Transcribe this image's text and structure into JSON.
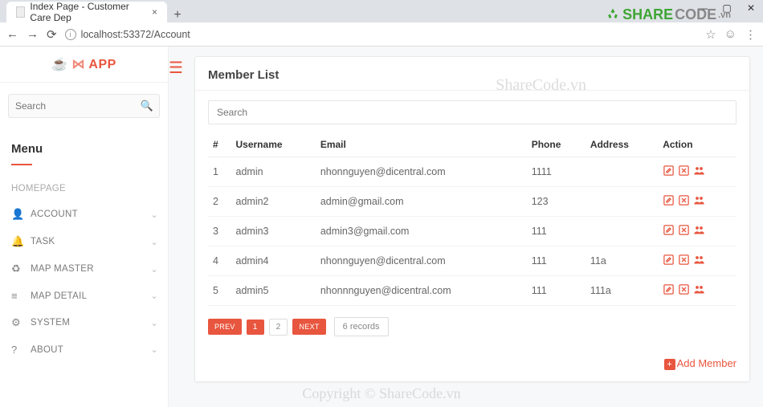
{
  "browser": {
    "tab_title": "Index Page - Customer Care Dep",
    "url": "localhost:53372/Account"
  },
  "brand": "APP",
  "sidebar": {
    "search_placeholder": "Search",
    "menu_label": "Menu",
    "items": [
      {
        "icon": "",
        "label": "HOMEPAGE",
        "chev": false
      },
      {
        "icon": "👤",
        "label": "ACCOUNT",
        "chev": true
      },
      {
        "icon": "🔔",
        "label": "TASK",
        "chev": true
      },
      {
        "icon": "♻",
        "label": "MAP MASTER",
        "chev": true
      },
      {
        "icon": "≡",
        "label": "MAP DETAIL",
        "chev": true
      },
      {
        "icon": "⚙",
        "label": "SYSTEM",
        "chev": true
      },
      {
        "icon": "?",
        "label": "ABOUT",
        "chev": true
      }
    ]
  },
  "card": {
    "title": "Member List",
    "search_placeholder": "Search",
    "columns": [
      "#",
      "Username",
      "Email",
      "Phone",
      "Address",
      "Action"
    ],
    "rows": [
      {
        "n": 1,
        "user": "admin",
        "email": "nhonnguyen@dicentral.com",
        "phone": "1111",
        "addr": ""
      },
      {
        "n": 2,
        "user": "admin2",
        "email": "admin@gmail.com",
        "phone": "123",
        "addr": ""
      },
      {
        "n": 3,
        "user": "admin3",
        "email": "admin3@gmail.com",
        "phone": "111",
        "addr": ""
      },
      {
        "n": 4,
        "user": "admin4",
        "email": "nhonnguyen@dicentral.com",
        "phone": "111",
        "addr": "11a"
      },
      {
        "n": 5,
        "user": "admin5",
        "email": "nhonnnguyen@dicentral.com",
        "phone": "111",
        "addr": "111a"
      }
    ],
    "pager": {
      "prev": "PREV",
      "pages": [
        "1",
        "2"
      ],
      "next": "NEXT",
      "records": "6 records"
    },
    "add_member": "Add Member"
  },
  "watermark": {
    "top": "ShareCode.vn",
    "bottom": "Copyright © ShareCode.vn",
    "badge1": "SHARE",
    "badge2": "CODE",
    "badge3": ".vn"
  }
}
